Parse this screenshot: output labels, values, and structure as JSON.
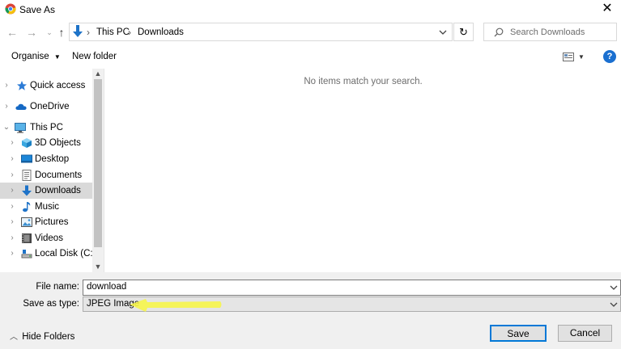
{
  "window": {
    "title": "Save As",
    "close_glyph": "✕"
  },
  "address": {
    "crumbs": [
      "This PC",
      "Downloads"
    ],
    "separator": "›",
    "search_placeholder": "Search Downloads"
  },
  "toolbar": {
    "organise_label": "Organise",
    "new_folder_label": "New folder"
  },
  "nav": {
    "items": [
      {
        "label": "Quick access",
        "icon": "star-icon"
      },
      {
        "label": "OneDrive",
        "icon": "cloud-icon"
      },
      {
        "label": "This PC",
        "icon": "computer-icon"
      },
      {
        "label": "3D Objects",
        "icon": "cube-icon"
      },
      {
        "label": "Desktop",
        "icon": "desktop-icon"
      },
      {
        "label": "Documents",
        "icon": "documents-icon"
      },
      {
        "label": "Downloads",
        "icon": "downloads-icon",
        "selected": true
      },
      {
        "label": "Music",
        "icon": "music-icon"
      },
      {
        "label": "Pictures",
        "icon": "pictures-icon"
      },
      {
        "label": "Videos",
        "icon": "videos-icon"
      },
      {
        "label": "Local Disk (C:)",
        "icon": "drive-icon"
      }
    ]
  },
  "content": {
    "empty_message": "No items match your search."
  },
  "form": {
    "file_name_label": "File name:",
    "file_name_value": "download",
    "save_type_label": "Save as type:",
    "save_type_value": "JPEG Image"
  },
  "footer": {
    "hide_folders_label": "Hide Folders",
    "save_label": "Save",
    "cancel_label": "Cancel"
  },
  "colors": {
    "accent": "#0078d7",
    "help": "#1a6fd0",
    "highlight_arrow": "#f5f542"
  }
}
